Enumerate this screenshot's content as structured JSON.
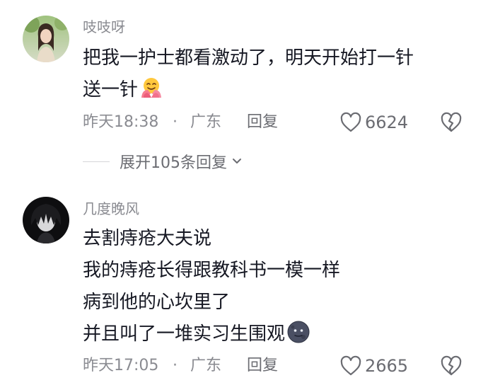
{
  "comments": [
    {
      "username": "吱吱呀",
      "lines": [
        "把我一护士都看激动了，明天开始打一针",
        "送一针"
      ],
      "emoji": "hugging-face-emoji",
      "time": "昨天18:38",
      "separator": "·",
      "location": "广东",
      "reply_label": "回复",
      "likes": "6624",
      "expand_replies": "展开105条回复"
    },
    {
      "username": "几度晚风",
      "lines": [
        "去割痔疮大夫说",
        "我的痔疮长得跟教科书一模一样",
        "病到他的心坎里了",
        "并且叫了一堆实习生围观"
      ],
      "emoji": "new-moon-face-emoji",
      "time": "昨天17:05",
      "separator": "·",
      "location": "广东",
      "reply_label": "回复",
      "likes": "2665"
    }
  ],
  "icons": {
    "like": "heart-outline-icon",
    "dislike": "broken-heart-icon",
    "expand": "chevron-down-icon"
  },
  "colors": {
    "text_primary": "#161823",
    "text_secondary": "#8a8b91",
    "icon": "#6b6c72"
  }
}
